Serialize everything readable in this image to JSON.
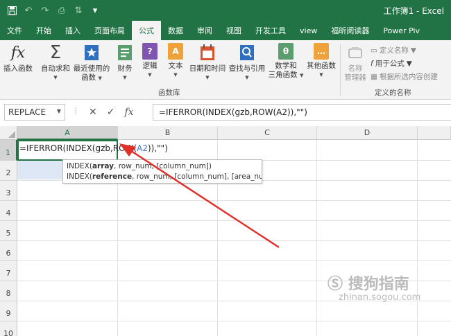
{
  "window": {
    "title": "工作簿1 - Excel",
    "theme_color": "#217346"
  },
  "quick_access": {
    "save_icon": "save-icon",
    "undo_icon": "undo-icon",
    "redo_icon": "redo-icon",
    "preview_icon": "print-preview-icon",
    "sort_icon": "sort-icon",
    "more_icon": "customize-qat-icon"
  },
  "tabs": [
    {
      "label": "文件"
    },
    {
      "label": "开始"
    },
    {
      "label": "插入"
    },
    {
      "label": "页面布局"
    },
    {
      "label": "公式",
      "active": true
    },
    {
      "label": "数据"
    },
    {
      "label": "审阅"
    },
    {
      "label": "视图"
    },
    {
      "label": "开发工具"
    },
    {
      "label": "view"
    },
    {
      "label": "福昕阅读器"
    },
    {
      "label": "Power Piv"
    }
  ],
  "ribbon": {
    "function_library": {
      "group_label": "函数库",
      "insert_function": {
        "label": "插入函数",
        "icon": "fx"
      },
      "autosum": {
        "label": "自动求和",
        "icon": "Σ"
      },
      "recent": {
        "label_1": "最近使用的",
        "label_2": "函数"
      },
      "financial": {
        "label": "财务"
      },
      "logical": {
        "label": "逻辑",
        "icon": "?"
      },
      "text": {
        "label": "文本",
        "icon": "A"
      },
      "datetime": {
        "label": "日期和时间"
      },
      "lookup": {
        "label": "查找与引用"
      },
      "math": {
        "label_1": "数学和",
        "label_2": "三角函数",
        "icon": "θ"
      },
      "other": {
        "label": "其他函数",
        "icon": "…"
      }
    },
    "defined_names": {
      "group_label": "定义的名称",
      "name_manager": {
        "label_1": "名称",
        "label_2": "管理器"
      },
      "define_name": "定义名称",
      "use_in_formula": "用于公式",
      "create_from_selection": "根据所选内容创建"
    }
  },
  "formula_bar": {
    "name_box": "REPLACE",
    "cancel": "✕",
    "enter": "✓",
    "fx": "fx",
    "formula": "=IFERROR(INDEX(gzb,ROW(A2)),\"\")"
  },
  "sheet": {
    "columns": [
      "A",
      "B",
      "C",
      "D"
    ],
    "rows": [
      "1",
      "2",
      "3",
      "4",
      "5",
      "6",
      "7",
      "8",
      "9",
      "10"
    ],
    "active_cell_parts": {
      "p1": "=IFERROR(INDEX(gzb,ROW(",
      "ref": "A2",
      "p2": ")),\"\")"
    },
    "ref_color": "#4472c4",
    "tooltip": {
      "line1": {
        "fn": "INDEX(",
        "arg": "array",
        "rest": ", row_num, [column_num])"
      },
      "line2": {
        "fn": "INDEX(",
        "arg": "reference",
        "rest": ", row_num, [column_num], [area_num])"
      }
    },
    "annotation_color": "#e0302a"
  },
  "watermark": {
    "main": "搜狗指南",
    "sub": "zhinan.sogou.com"
  }
}
